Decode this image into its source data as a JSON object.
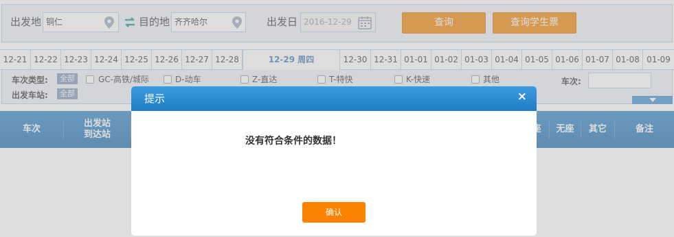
{
  "search": {
    "from_label": "出发地",
    "from_value": "铜仁",
    "to_label": "目的地",
    "to_value": "齐齐哈尔",
    "date_label": "出发日",
    "date_value": "2016-12-29",
    "query_button": "查询",
    "student_button": "查询学生票"
  },
  "dates": [
    "12-21",
    "12-22",
    "12-23",
    "12-24",
    "12-25",
    "12-26",
    "12-27",
    "12-28",
    "12-29 周四",
    "12-30",
    "12-31",
    "01-01",
    "01-02",
    "01-03",
    "01-04",
    "01-05",
    "01-06",
    "01-07",
    "01-08",
    "01-09"
  ],
  "filters": {
    "type_label": "车次类型:",
    "station_label": "出发车站:",
    "all_label": "全部",
    "types": [
      "GC-高铁/城际",
      "D-动车",
      "Z-直达",
      "T-特快",
      "K-快速",
      "其他"
    ],
    "train_no_label": "车次:"
  },
  "table_header": {
    "col1": "车次",
    "col2_line1": "出发站",
    "col2_line2": "到达站",
    "partial": "座",
    "no_seat": "无座",
    "other": "其它",
    "note": "备注"
  },
  "modal": {
    "title": "提示",
    "close": "×",
    "message": "没有符合条件的数据！",
    "ok": "确认"
  },
  "colors": {
    "accent_orange": "#f08300",
    "header_blue": "#1f7cc4"
  }
}
